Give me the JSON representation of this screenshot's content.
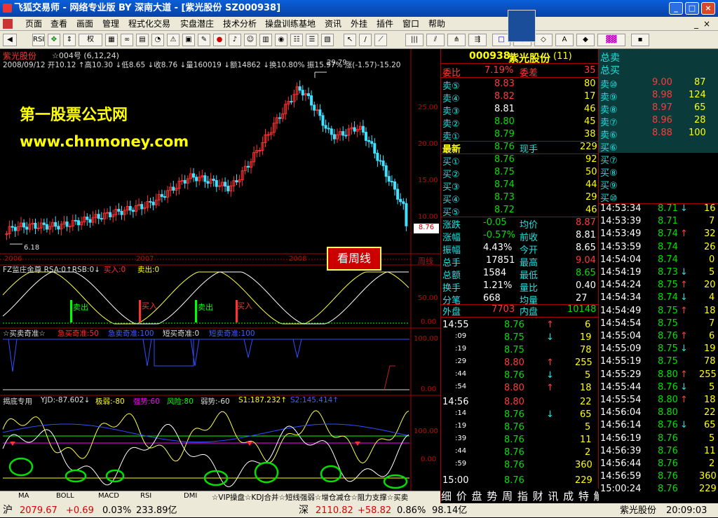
{
  "window": {
    "title": "飞狐交易师 - 网络专业版 BY 深南大道 - [紫光股份  SZ000938]",
    "btn_min": "_",
    "btn_max": "□",
    "btn_close": "×"
  },
  "menu": [
    "页面",
    "查看",
    "画面",
    "管理",
    "程式化交易",
    "实盘潜庄",
    "技术分析",
    "操盘训练基地",
    "资讯",
    "外挂",
    "插件",
    "窗口",
    "帮助"
  ],
  "toolbar": {
    "quan": "权",
    "rsi": "RSI"
  },
  "watermark": {
    "line1": "第一股票公式网",
    "line2": "www.chnmoney.com"
  },
  "chart": {
    "name": "紫光股份",
    "period": "☆004号 (6,12,24)",
    "info": "2008/09/12 开10.12 ↑高10.30 ↓低8.65 ↓收8.76 ↓量160019 ↓额14862 ↓换10.80% 振15.97% 涨(-1.57)-15.20",
    "high_label": "29.79",
    "low_label": "6.18",
    "last_label": "8.76",
    "price_ticks": [
      "25.00",
      "20.00",
      "15.00",
      "10.00"
    ],
    "years": [
      "2006",
      "2007",
      "2008"
    ],
    "weekly": "周线",
    "see_weekly": "看周线",
    "ind1_title": "FZ监庄金尊 RSA:0↑RSB:0↓",
    "ind1_buy": "买入:0",
    "ind1_sell": "卖出:0",
    "ind1_ticks": [
      "50.00",
      "0.00"
    ],
    "ind1_marks": {
      "sell": "卖出",
      "buy": "买入"
    },
    "ind2_title": "☆买卖奇准☆",
    "ind2_a": "急买奇准:50",
    "ind2_b": "急卖奇准:100",
    "ind2_c": "短买奇准:0",
    "ind2_d": "短卖奇准:100",
    "ind2_ticks": [
      "100.00",
      "0.00"
    ],
    "ind3_title": "揭底专用",
    "ind3_a": "YJD:-87.602↓",
    "ind3_b": "极弱:-80",
    "ind3_c": "强势:60",
    "ind3_d": "风险:80",
    "ind3_e": "弱势:-60",
    "ind3_f": "S1:187.232↑",
    "ind3_g": "S2:145.414↑",
    "ind3_ticks": [
      "100.00",
      "0.00"
    ],
    "tabs": [
      "MA",
      "BOLL",
      "MACD",
      "RSI",
      "DMI"
    ],
    "ticker": "☆VIP操盘☆KDJ合并☆短线强弱☆增仓减仓☆阻力支撑☆买卖"
  },
  "chart_data": {
    "type": "candlestick",
    "high": 29.79,
    "low": 6.18,
    "last": 8.76,
    "ylim": [
      5,
      31
    ]
  },
  "quote": {
    "code": "000938",
    "name": "紫光股份",
    "count": "(11)",
    "weibi": "委比",
    "weibi_v": "7.19%",
    "weicha": "委差",
    "weicha_v": "35",
    "sell": [
      {
        "l": "卖⑤",
        "p": "8.83",
        "v": "80"
      },
      {
        "l": "卖④",
        "p": "8.82",
        "v": "17"
      },
      {
        "l": "卖③",
        "p": "8.81",
        "v": "46"
      },
      {
        "l": "卖②",
        "p": "8.80",
        "v": "45"
      },
      {
        "l": "卖①",
        "p": "8.79",
        "v": "38"
      }
    ],
    "latest": "最新",
    "latest_v": "8.76",
    "xianshou": "现手",
    "xianshou_v": "229",
    "buy": [
      {
        "l": "买①",
        "p": "8.76",
        "v": "92"
      },
      {
        "l": "买②",
        "p": "8.75",
        "v": "50"
      },
      {
        "l": "买③",
        "p": "8.74",
        "v": "44"
      },
      {
        "l": "买④",
        "p": "8.73",
        "v": "29"
      },
      {
        "l": "买⑤",
        "p": "8.72",
        "v": "46"
      }
    ],
    "stats": [
      {
        "a": "涨跌",
        "av": "-0.05",
        "b": "均价",
        "bv": "8.87"
      },
      {
        "a": "涨幅",
        "av": "-0.57%",
        "b": "前收",
        "bv": "8.81"
      },
      {
        "a": "振幅",
        "av": "4.43%",
        "b": "今开",
        "bv": "8.65"
      },
      {
        "a": "总手",
        "av": "17851",
        "b": "最高",
        "bv": "9.04"
      },
      {
        "a": "总额",
        "av": "1584",
        "b": "最低",
        "bv": "8.65"
      },
      {
        "a": "换手",
        "av": "1.21%",
        "b": "量比",
        "bv": "0.40"
      },
      {
        "a": "分笔",
        "av": "668",
        "b": "均量",
        "bv": "27"
      }
    ],
    "waipan": "外盘",
    "waipan_v": "7703",
    "neipan": "内盘",
    "neipan_v": "10148",
    "ticks": [
      {
        "t": "14:55",
        "p": "8.76",
        "a": "↑",
        "v": "6"
      },
      {
        "t": ":09",
        "p": "8.75",
        "a": "↓",
        "v": "19"
      },
      {
        "t": ":19",
        "p": "8.75",
        "a": "",
        "v": "78"
      },
      {
        "t": ":29",
        "p": "8.80",
        "a": "↑",
        "v": "255"
      },
      {
        "t": ":44",
        "p": "8.76",
        "a": "↓",
        "v": "5"
      },
      {
        "t": ":54",
        "p": "8.80",
        "a": "↑",
        "v": "18"
      },
      {
        "t": "14:56",
        "p": "8.80",
        "a": "",
        "v": "22"
      },
      {
        "t": ":14",
        "p": "8.76",
        "a": "↓",
        "v": "65"
      },
      {
        "t": ":19",
        "p": "8.76",
        "a": "",
        "v": "5"
      },
      {
        "t": ":39",
        "p": "8.76",
        "a": "",
        "v": "11"
      },
      {
        "t": ":44",
        "p": "8.76",
        "a": "",
        "v": "2"
      },
      {
        "t": ":59",
        "p": "8.76",
        "a": "",
        "v": "360"
      },
      {
        "t": "15:00",
        "p": "8.76",
        "a": "",
        "v": "229"
      }
    ],
    "bottom_tabs": "细 价 盘 势 周 指 财 讯 成 特 解"
  },
  "side": {
    "zongmai": "总卖",
    "zongmai2": "总买",
    "sell": [
      {
        "l": "卖⑩",
        "p": "9.00",
        "v": "87"
      },
      {
        "l": "卖⑨",
        "p": "8.98",
        "v": "124"
      },
      {
        "l": "卖⑧",
        "p": "8.97",
        "v": "65"
      },
      {
        "l": "卖⑦",
        "p": "8.96",
        "v": "28"
      },
      {
        "l": "卖⑥",
        "p": "8.88",
        "v": "100"
      }
    ],
    "buy": [
      "买⑥",
      "买⑦",
      "买⑧",
      "买⑨",
      "买⑩"
    ],
    "ticks": [
      {
        "t": "14:53:34",
        "p": "8.71",
        "a": "↓",
        "v": "16"
      },
      {
        "t": "14:53:39",
        "p": "8.71",
        "a": "",
        "v": "7"
      },
      {
        "t": "14:53:49",
        "p": "8.74",
        "a": "↑",
        "v": "32"
      },
      {
        "t": "14:53:59",
        "p": "8.74",
        "a": "",
        "v": "26"
      },
      {
        "t": "14:54:04",
        "p": "8.74",
        "a": "",
        "v": "0"
      },
      {
        "t": "14:54:19",
        "p": "8.73",
        "a": "↓",
        "v": "5"
      },
      {
        "t": "14:54:24",
        "p": "8.75",
        "a": "↑",
        "v": "20"
      },
      {
        "t": "14:54:34",
        "p": "8.74",
        "a": "↓",
        "v": "4"
      },
      {
        "t": "14:54:49",
        "p": "8.75",
        "a": "↑",
        "v": "18"
      },
      {
        "t": "14:54:54",
        "p": "8.75",
        "a": "",
        "v": "7"
      },
      {
        "t": "14:55:04",
        "p": "8.76",
        "a": "↑",
        "v": "6"
      },
      {
        "t": "14:55:09",
        "p": "8.75",
        "a": "↓",
        "v": "19"
      },
      {
        "t": "14:55:19",
        "p": "8.75",
        "a": "",
        "v": "78"
      },
      {
        "t": "14:55:29",
        "p": "8.80",
        "a": "↑",
        "v": "255"
      },
      {
        "t": "14:55:44",
        "p": "8.76",
        "a": "↓",
        "v": "5"
      },
      {
        "t": "14:55:54",
        "p": "8.80",
        "a": "↑",
        "v": "18"
      },
      {
        "t": "14:56:04",
        "p": "8.80",
        "a": "",
        "v": "22"
      },
      {
        "t": "14:56:14",
        "p": "8.76",
        "a": "↓",
        "v": "65"
      },
      {
        "t": "14:56:19",
        "p": "8.76",
        "a": "",
        "v": "5"
      },
      {
        "t": "14:56:39",
        "p": "8.76",
        "a": "",
        "v": "11"
      },
      {
        "t": "14:56:44",
        "p": "8.76",
        "a": "",
        "v": "2"
      },
      {
        "t": "14:56:59",
        "p": "8.76",
        "a": "",
        "v": "360"
      },
      {
        "t": "15:00:24",
        "p": "8.76",
        "a": "",
        "v": "229"
      }
    ]
  },
  "status": {
    "sh": "沪",
    "sh_v": "2079.67",
    "sh_c": "+0.69",
    "sh_p": "0.03%",
    "sh_a": "233.89亿",
    "sz": "深",
    "sz_v": "2110.82",
    "sz_c": "+58.82",
    "sz_p": "0.86%",
    "sz_a": "98.14亿",
    "stock": "紫光股份",
    "time": "20:09:03"
  }
}
